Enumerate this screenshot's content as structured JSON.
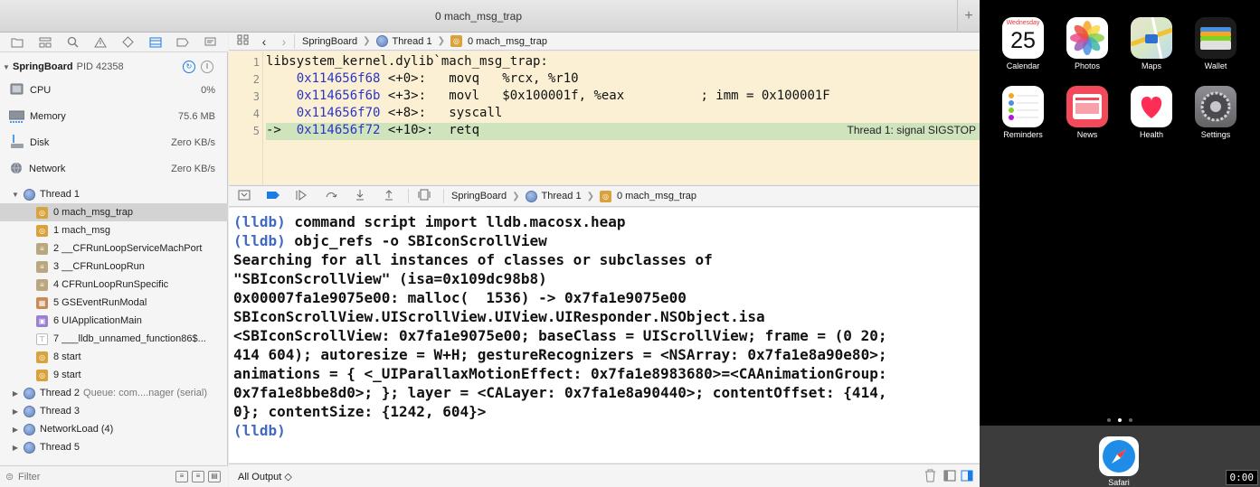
{
  "window": {
    "title": "0 mach_msg_trap",
    "add_tab_label": "+"
  },
  "navigator": {
    "process": {
      "name": "SpringBoard",
      "pid": "PID 42358"
    },
    "gauges": [
      {
        "label": "CPU",
        "value": "0%"
      },
      {
        "label": "Memory",
        "value": "75.6 MB"
      },
      {
        "label": "Disk",
        "value": "Zero KB/s"
      },
      {
        "label": "Network",
        "value": "Zero KB/s"
      }
    ],
    "thread1": {
      "label": "Thread 1"
    },
    "frames": [
      {
        "label": "0 mach_msg_trap"
      },
      {
        "label": "1 mach_msg"
      },
      {
        "label": "2 __CFRunLoopServiceMachPort"
      },
      {
        "label": "3 __CFRunLoopRun"
      },
      {
        "label": "4 CFRunLoopRunSpecific"
      },
      {
        "label": "5 GSEventRunModal"
      },
      {
        "label": "6 UIApplicationMain"
      },
      {
        "label": "7 ___lldb_unnamed_function86$..."
      },
      {
        "label": "8 start"
      },
      {
        "label": "9 start"
      }
    ],
    "other_threads": [
      {
        "label": "Thread 2",
        "detail": "Queue: com....nager (serial)"
      },
      {
        "label": "Thread 3",
        "detail": ""
      },
      {
        "label": "NetworkLoad (4)",
        "detail": ""
      },
      {
        "label": "Thread 5",
        "detail": ""
      }
    ],
    "filter_placeholder": "Filter"
  },
  "jumpbar": {
    "items": [
      "SpringBoard",
      "Thread 1",
      "0 mach_msg_trap"
    ]
  },
  "editor": {
    "line_numbers": [
      "1",
      "2",
      "3",
      "4",
      "5"
    ],
    "lines": [
      {
        "head": "libsystem_kernel.dylib`mach_msg_trap:",
        "addr": "",
        "off": "",
        "instr": ""
      },
      {
        "head": "    ",
        "addr": "0x114656f68",
        "off": " <+0>:  ",
        "instr": " movq   %rcx, %r10"
      },
      {
        "head": "    ",
        "addr": "0x114656f6b",
        "off": " <+3>:  ",
        "instr": " movl   $0x100001f, %eax          ; imm = 0x100001F"
      },
      {
        "head": "    ",
        "addr": "0x114656f70",
        "off": " <+8>:  ",
        "instr": " syscall"
      },
      {
        "head": "->  ",
        "addr": "0x114656f72",
        "off": " <+10>: ",
        "instr": " retq"
      }
    ],
    "signal_annotation": "Thread 1: signal SIGSTOP"
  },
  "console": {
    "lines": [
      {
        "prompt": "(lldb)",
        "text": " command script import lldb.macosx.heap"
      },
      {
        "prompt": "(lldb)",
        "text": " objc_refs -o SBIconScrollView"
      },
      {
        "prompt": "",
        "text": "Searching for all instances of classes or subclasses of"
      },
      {
        "prompt": "",
        "text": "\"SBIconScrollView\" (isa=0x109dc98b8)"
      },
      {
        "prompt": "",
        "text": "0x00007fa1e9075e00: malloc(  1536) -> 0x7fa1e9075e00"
      },
      {
        "prompt": "",
        "text": "SBIconScrollView.UIScrollView.UIView.UIResponder.NSObject.isa"
      },
      {
        "prompt": "",
        "text": "<SBIconScrollView: 0x7fa1e9075e00; baseClass = UIScrollView; frame = (0 20;"
      },
      {
        "prompt": "",
        "text": "414 604); autoresize = W+H; gestureRecognizers = <NSArray: 0x7fa1e8a90e80>;"
      },
      {
        "prompt": "",
        "text": "animations = { <_UIParallaxMotionEffect: 0x7fa1e8983680>=<CAAnimationGroup:"
      },
      {
        "prompt": "",
        "text": "0x7fa1e8bbe8d0>; }; layer = <CALayer: 0x7fa1e8a90440>; contentOffset: {414,"
      },
      {
        "prompt": "",
        "text": "0}; contentSize: {1242, 604}>"
      },
      {
        "prompt": "(lldb)",
        "text": ""
      }
    ],
    "output_selector": "All Output ◇"
  },
  "simulator": {
    "apps_row1": [
      {
        "label": "Calendar",
        "icon": "calendar-icon",
        "day": "Wednesday",
        "date": "25"
      },
      {
        "label": "Photos",
        "icon": "photos-icon"
      },
      {
        "label": "Maps",
        "icon": "maps-icon"
      },
      {
        "label": "Wallet",
        "icon": "wallet-icon"
      }
    ],
    "apps_row2": [
      {
        "label": "Reminders",
        "icon": "reminders-icon"
      },
      {
        "label": "News",
        "icon": "news-icon"
      },
      {
        "label": "Health",
        "icon": "health-icon"
      },
      {
        "label": "Settings",
        "icon": "settings-icon"
      }
    ],
    "dock": [
      {
        "label": "Safari",
        "icon": "safari-icon"
      }
    ],
    "timer": "0:00"
  }
}
